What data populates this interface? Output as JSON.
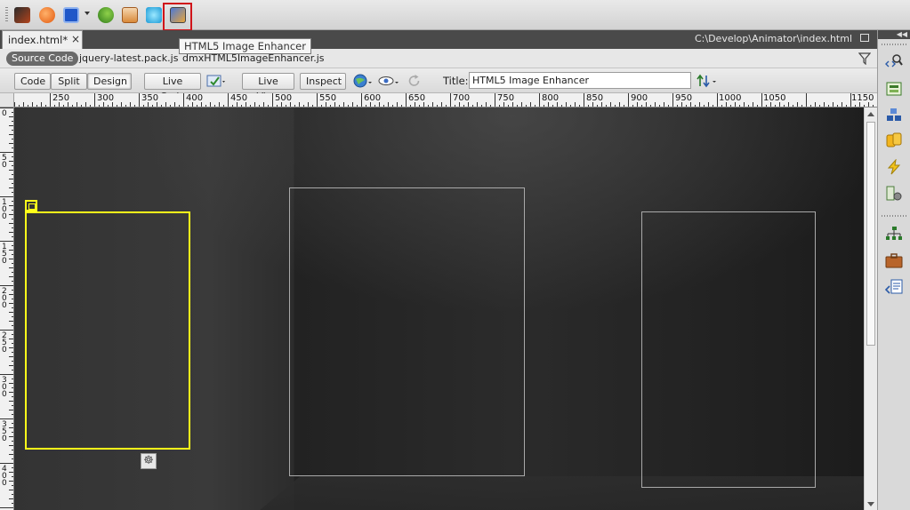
{
  "toolbar": {
    "icons": [
      "flash-icon",
      "contribute-icon",
      "shape-icon",
      "browser-refresh-icon",
      "site-icon",
      "adobe-air-icon",
      "html5-image-enhancer-icon"
    ],
    "tooltip": "HTML5 Image Enhancer"
  },
  "document": {
    "tab_label": "index.html*",
    "path": "C:\\Develop\\Animator\\index.html"
  },
  "related_files": {
    "source_code": "Source Code",
    "files": [
      "jquery-latest.pack.js",
      "dmxHTML5ImageEnhancer.js"
    ]
  },
  "doc_toolbar": {
    "code": "Code",
    "split": "Split",
    "design": "Design",
    "active_view": "Design",
    "live_code": "Live Code",
    "live_view": "Live View",
    "inspect": "Inspect",
    "title_label": "Title:",
    "title_value": "HTML5 Image Enhancer"
  },
  "ruler": {
    "h_labels": [
      "250",
      "300",
      "350",
      "400",
      "450",
      "500",
      "550",
      "600",
      "650",
      "700",
      "750",
      "800",
      "850",
      "900",
      "950",
      "1000",
      "1050",
      "1150"
    ],
    "v_labels": [
      "0",
      "50",
      "100",
      "150",
      "200",
      "250",
      "300",
      "350",
      "400"
    ]
  },
  "right_panel": {
    "icons": [
      "code-navigator-icon",
      "css-panel-icon",
      "ap-elements-icon",
      "databases-icon",
      "behaviors-icon",
      "server-behaviors-icon",
      "files-icon",
      "assets-icon",
      "snippets-icon"
    ]
  }
}
